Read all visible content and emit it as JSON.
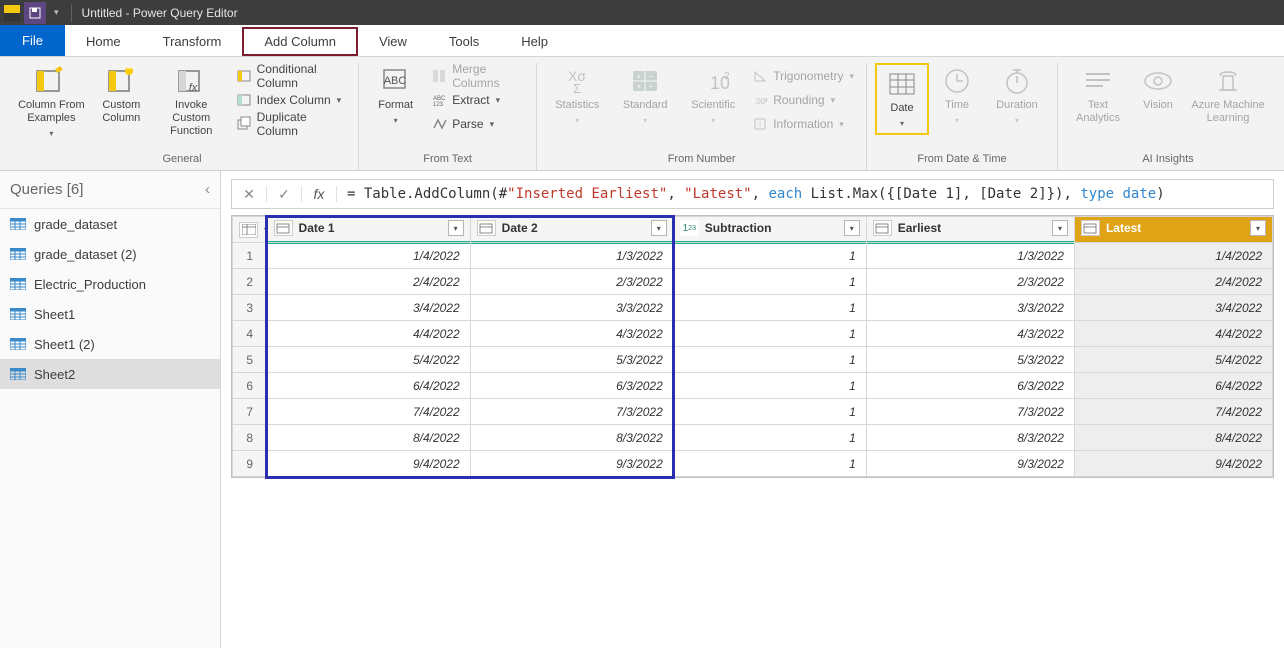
{
  "title": "Untitled - Power Query Editor",
  "tabs": {
    "file": "File",
    "home": "Home",
    "transform": "Transform",
    "add_column": "Add Column",
    "view": "View",
    "tools": "Tools",
    "help": "Help"
  },
  "ribbon": {
    "general": {
      "label": "General",
      "col_from_examples": "Column From\nExamples",
      "custom_column": "Custom\nColumn",
      "invoke_custom": "Invoke Custom\nFunction",
      "conditional": "Conditional Column",
      "index": "Index Column",
      "duplicate": "Duplicate Column"
    },
    "from_text": {
      "label": "From Text",
      "format": "Format",
      "merge": "Merge Columns",
      "extract": "Extract",
      "parse": "Parse"
    },
    "from_number": {
      "label": "From Number",
      "statistics": "Statistics",
      "standard": "Standard",
      "scientific": "Scientific",
      "trig": "Trigonometry",
      "rounding": "Rounding",
      "info": "Information"
    },
    "from_date_time": {
      "label": "From Date & Time",
      "date": "Date",
      "time": "Time",
      "duration": "Duration"
    },
    "ai": {
      "label": "AI Insights",
      "text_analytics": "Text\nAnalytics",
      "vision": "Vision",
      "aml": "Azure Machine\nLearning"
    }
  },
  "queries": {
    "title": "Queries [6]",
    "items": [
      {
        "label": "grade_dataset"
      },
      {
        "label": "grade_dataset (2)"
      },
      {
        "label": "Electric_Production"
      },
      {
        "label": "Sheet1"
      },
      {
        "label": "Sheet1 (2)"
      },
      {
        "label": "Sheet2"
      }
    ]
  },
  "formula": {
    "prefix": "= Table.AddColumn(#",
    "arg1": "\"Inserted Earliest\"",
    "sep1": ", ",
    "arg2": "\"Latest\"",
    "sep2": ", ",
    "each_kw": "each",
    "mid": " List.Max({[Date 1], [Date 2]}), ",
    "type_kw": "type",
    "sp": " ",
    "date_kw": "date",
    "end": ")"
  },
  "grid": {
    "columns": [
      "Date 1",
      "Date 2",
      "Subtraction",
      "Earliest",
      "Latest"
    ],
    "type_icons": [
      "date",
      "date",
      "number",
      "date",
      "date"
    ],
    "rows": [
      {
        "n": "1",
        "date1": "1/4/2022",
        "date2": "1/3/2022",
        "sub": "1",
        "earl": "1/3/2022",
        "latest": "1/4/2022"
      },
      {
        "n": "2",
        "date1": "2/4/2022",
        "date2": "2/3/2022",
        "sub": "1",
        "earl": "2/3/2022",
        "latest": "2/4/2022"
      },
      {
        "n": "3",
        "date1": "3/4/2022",
        "date2": "3/3/2022",
        "sub": "1",
        "earl": "3/3/2022",
        "latest": "3/4/2022"
      },
      {
        "n": "4",
        "date1": "4/4/2022",
        "date2": "4/3/2022",
        "sub": "1",
        "earl": "4/3/2022",
        "latest": "4/4/2022"
      },
      {
        "n": "5",
        "date1": "5/4/2022",
        "date2": "5/3/2022",
        "sub": "1",
        "earl": "5/3/2022",
        "latest": "5/4/2022"
      },
      {
        "n": "6",
        "date1": "6/4/2022",
        "date2": "6/3/2022",
        "sub": "1",
        "earl": "6/3/2022",
        "latest": "6/4/2022"
      },
      {
        "n": "7",
        "date1": "7/4/2022",
        "date2": "7/3/2022",
        "sub": "1",
        "earl": "7/3/2022",
        "latest": "7/4/2022"
      },
      {
        "n": "8",
        "date1": "8/4/2022",
        "date2": "8/3/2022",
        "sub": "1",
        "earl": "8/3/2022",
        "latest": "8/4/2022"
      },
      {
        "n": "9",
        "date1": "9/4/2022",
        "date2": "9/3/2022",
        "sub": "1",
        "earl": "9/3/2022",
        "latest": "9/4/2022"
      }
    ]
  }
}
